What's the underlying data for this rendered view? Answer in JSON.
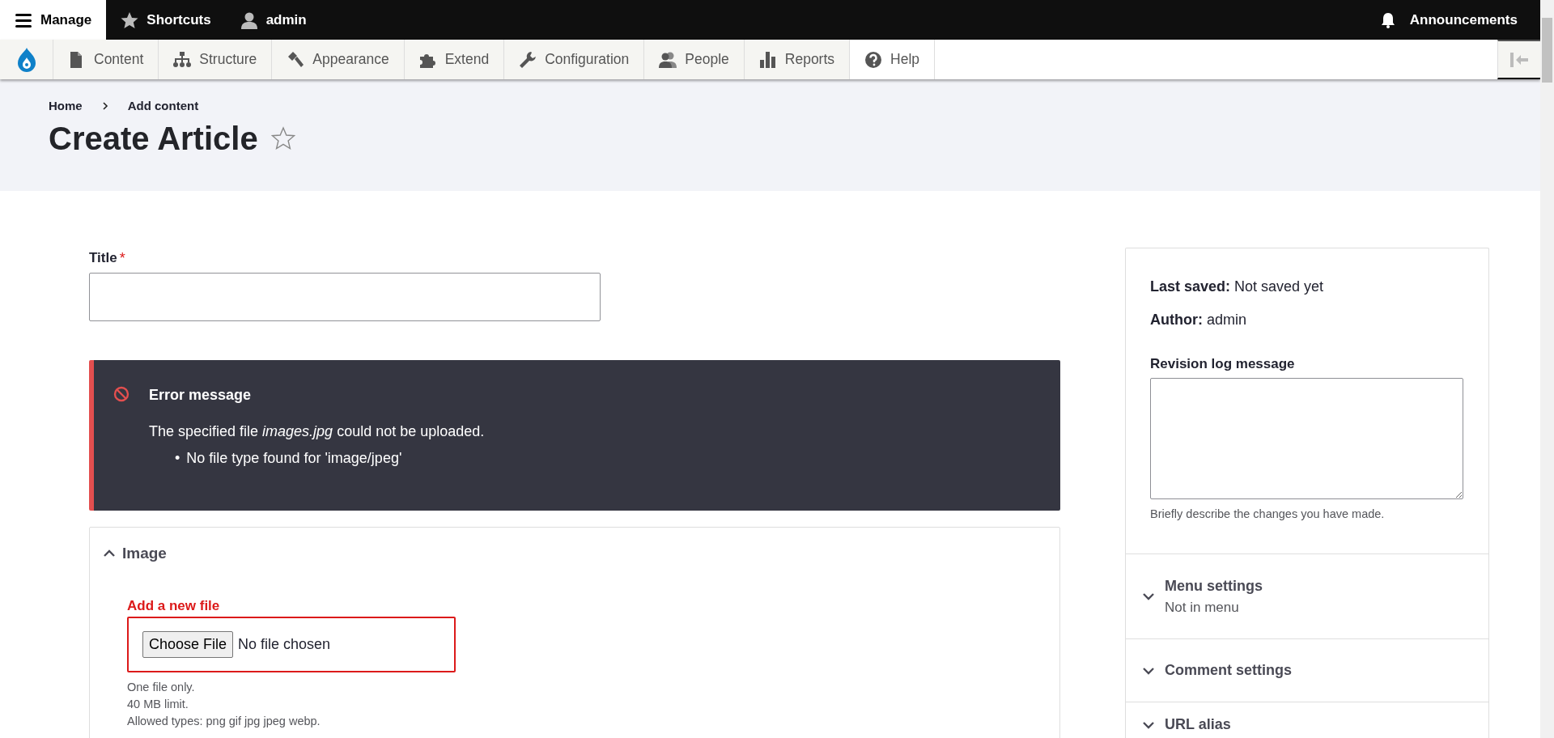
{
  "toolbar": {
    "items": [
      {
        "label": "Manage",
        "selected": true
      },
      {
        "label": "Shortcuts",
        "selected": false
      },
      {
        "label": "admin",
        "selected": false
      }
    ],
    "announcements": "Announcements"
  },
  "admin_menu": [
    {
      "label": "Content",
      "selected": false
    },
    {
      "label": "Structure",
      "selected": false
    },
    {
      "label": "Appearance",
      "selected": false
    },
    {
      "label": "Extend",
      "selected": false
    },
    {
      "label": "Configuration",
      "selected": false
    },
    {
      "label": "People",
      "selected": false
    },
    {
      "label": "Reports",
      "selected": false
    },
    {
      "label": "Help",
      "selected": true
    }
  ],
  "breadcrumb": [
    "Home",
    "Add content"
  ],
  "page_title": "Create Article",
  "form": {
    "title_label": "Title",
    "required_mark": "*",
    "error": {
      "heading": "Error message",
      "text": "The specified file *images.jpg* could not be uploaded.",
      "bullet": "•",
      "items": [
        "No file type found for 'image/jpeg'"
      ]
    },
    "image_section": {
      "summary": "Image",
      "expanded": true,
      "field_label": "Add a new file",
      "has_error": true,
      "file_button": "Choose File",
      "file_status": "No file chosen",
      "help": [
        "One file only.",
        "40 MB limit.",
        "Allowed types: png gif jpg jpeg webp."
      ]
    }
  },
  "sidebar": {
    "last_saved": "**Last saved:** Not saved yet",
    "author": "**Author:** admin",
    "revision_label": "Revision log message",
    "revision_help": "Briefly describe the changes you have made.",
    "sections": [
      {
        "title": "Menu settings",
        "summary": "Not in menu",
        "expanded": false
      },
      {
        "title": "Comment settings",
        "expanded": false
      },
      {
        "title": "URL alias",
        "expanded": false
      }
    ]
  }
}
